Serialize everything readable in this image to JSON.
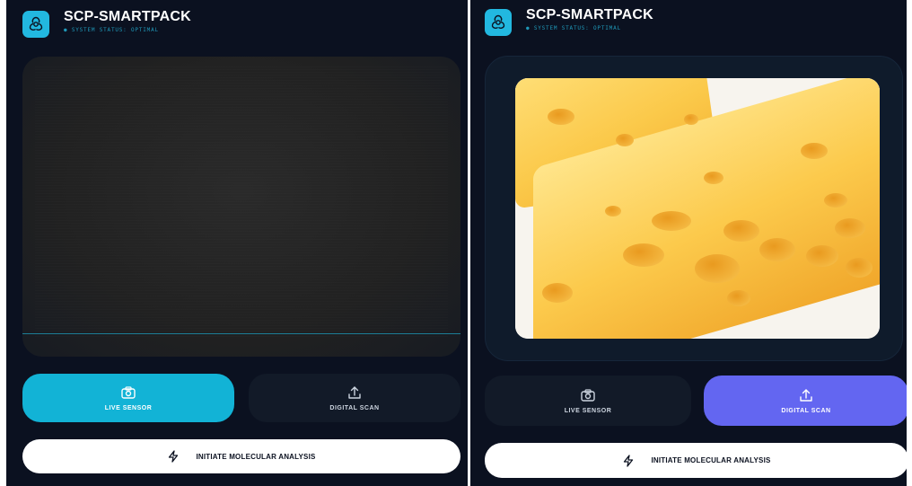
{
  "app": {
    "title": "SCP-SMARTPACK",
    "status": "● SYSTEM STATUS: OPTIMAL",
    "logo_icon": "biohazard-icon",
    "accent": "#12b3d6"
  },
  "screens": [
    {
      "mode": "live",
      "buttons": {
        "live_sensor": "LIVE SENSOR",
        "digital_scan": "DIGITAL SCAN",
        "active": "live_sensor",
        "active_color": "#12b3d6"
      },
      "analyze": "INITIATE MOLECULAR ANALYSIS"
    },
    {
      "mode": "digital",
      "buttons": {
        "live_sensor": "LIVE SENSOR",
        "digital_scan": "DIGITAL SCAN",
        "active": "digital_scan",
        "active_color": "#6366f1"
      },
      "analyze": "INITIATE MOLECULAR ANALYSIS"
    }
  ],
  "icons": {
    "live_sensor": "camera-icon",
    "digital_scan": "upload-icon",
    "analyze": "lightning-icon"
  }
}
